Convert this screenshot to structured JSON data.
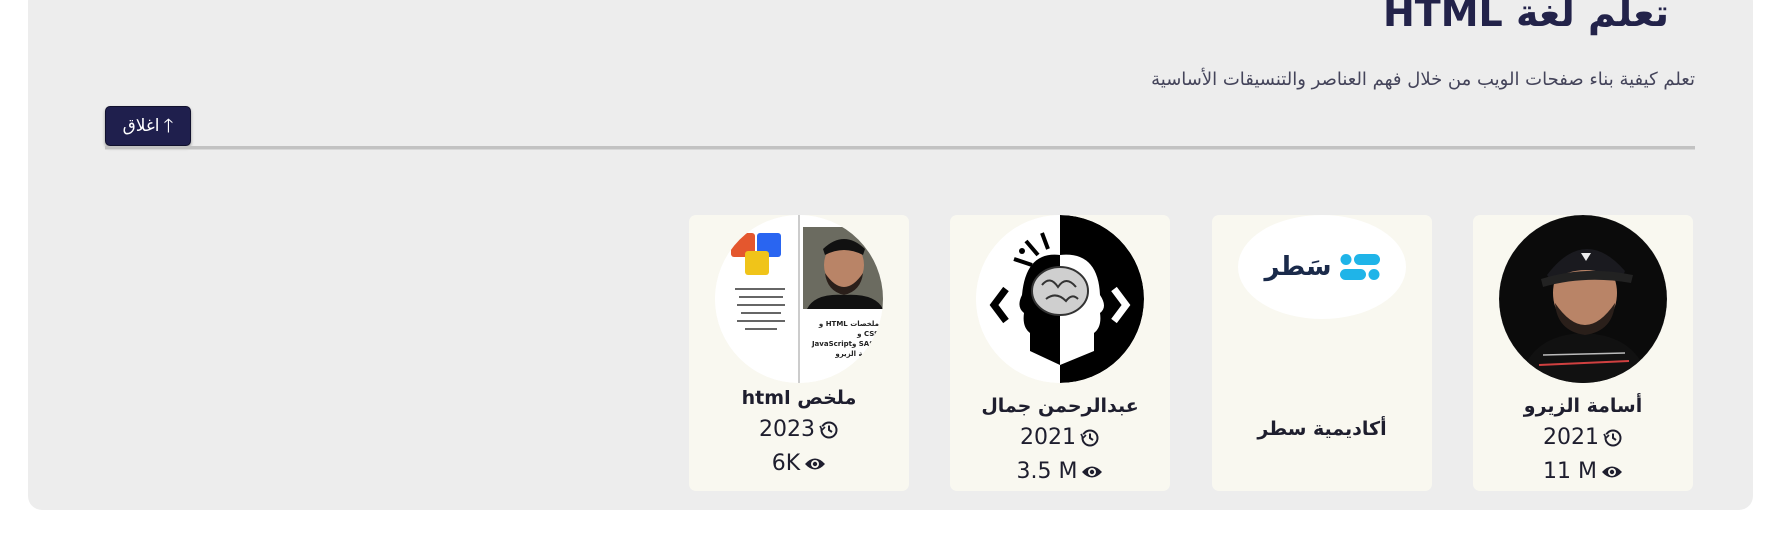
{
  "section": {
    "title": "تعلم لغة HTML",
    "subtitle": "تعلم كيفية بناء صفحات الويب من خلال فهم العناصر والتنسيقات الأساسية",
    "close_label": "اغلاق",
    "close_icon": "arrow-up-icon"
  },
  "cards": [
    {
      "name": "أسامة الزيرو",
      "year": "2021",
      "views": "11 M",
      "thumb": "instructor-photo"
    },
    {
      "name": "أكاديمية سطر",
      "logo_text": "سَطر",
      "thumb": "satr-logo"
    },
    {
      "name": "عبدالرحمن جمال",
      "year": "2021",
      "views": "3.5 M",
      "thumb": "brain-code-logo"
    },
    {
      "name": "ملخص html",
      "year": "2023",
      "views": "6K",
      "thumb": "summary-cover",
      "thumb_lines": [
        "ملخصات HTML و CSS و",
        "SASS وJavaScript أسامة الزيرو"
      ]
    }
  ],
  "colors": {
    "accent": "#23234a",
    "button": "#1f1f4d",
    "card": "#f9f8f0",
    "panel": "#ededed",
    "satr_blue": "#1fb4e8"
  }
}
